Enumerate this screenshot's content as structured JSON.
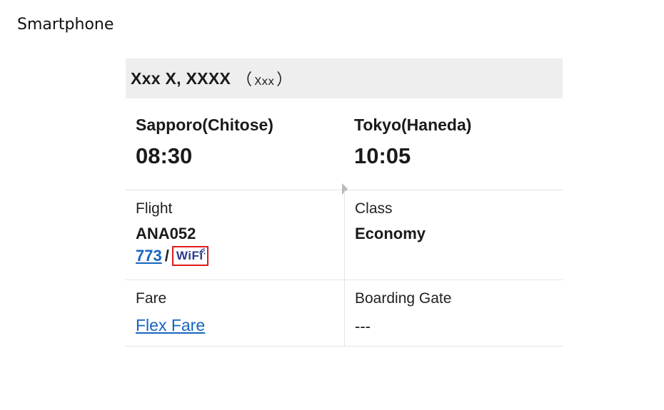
{
  "page_heading": "Smartphone",
  "date_bar": {
    "date": "Xxx X, XXXX",
    "weekday": "Xxx",
    "open_paren": "（",
    "close_paren": "）"
  },
  "route": {
    "departure": {
      "station": "Sapporo(Chitose)",
      "time": "08:30"
    },
    "arrival": {
      "station": "Tokyo(Haneda)",
      "time": "10:05"
    },
    "arrow_icon": "triangle-right-icon"
  },
  "flight": {
    "label": "Flight",
    "number": "ANA052",
    "aircraft_link": "773",
    "separator": "/",
    "wifi_label": "WiFi",
    "wifi_icon": "wifi-icon",
    "highlight_color": "#e01b1b"
  },
  "class_info": {
    "label": "Class",
    "value": "Economy"
  },
  "fare": {
    "label": "Fare",
    "value": "Flex Fare"
  },
  "boarding_gate": {
    "label": "Boarding Gate",
    "value": "---"
  },
  "colors": {
    "link": "#1565c0",
    "date_bar_bg": "#eeeeee",
    "wifi_text": "#2b3a8a"
  }
}
